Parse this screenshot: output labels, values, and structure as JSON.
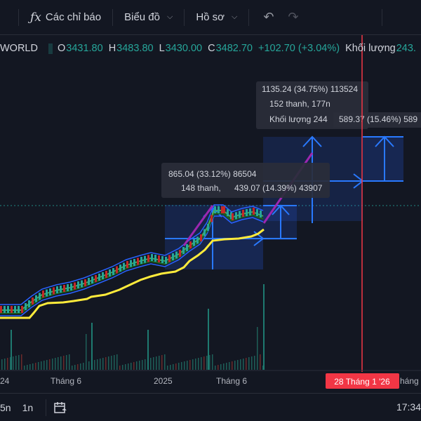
{
  "toolbar": {
    "indicators_label": "Các chỉ báo",
    "chart_type_label": "Biểu đồ",
    "profile_label": "Hồ sơ"
  },
  "legend": {
    "symbol": "WORLD",
    "o_key": "O",
    "o_val": "3431.80",
    "h_key": "H",
    "h_val": "3483.80",
    "l_key": "L",
    "l_val": "3430.00",
    "c_key": "C",
    "c_val": "3482.70",
    "change": "+102.70 (+3.04%)",
    "volume_label": "Khối lượng",
    "volume_val": "243.",
    "up_color": "#26a69a"
  },
  "measure1": {
    "line1": "865.04 (33.12%) 86504",
    "line2a": "148 thanh,",
    "line2b": "439.07 (14.39%) 43907"
  },
  "measure2": {
    "line1": "1135.24 (34.75%) 113524",
    "line2": "152 thanh, 177n",
    "line3a": "Khối lượng 244",
    "line3b": "589.37 (15.46%) 589"
  },
  "xaxis": {
    "labels": [
      "24",
      "Tháng 6",
      "2025",
      "Tháng 6",
      "háng"
    ],
    "cursor_label": "28 Tháng 1 '26"
  },
  "bottom": {
    "range_a": "5n",
    "range_b": "1n",
    "clock": "17:34"
  }
}
